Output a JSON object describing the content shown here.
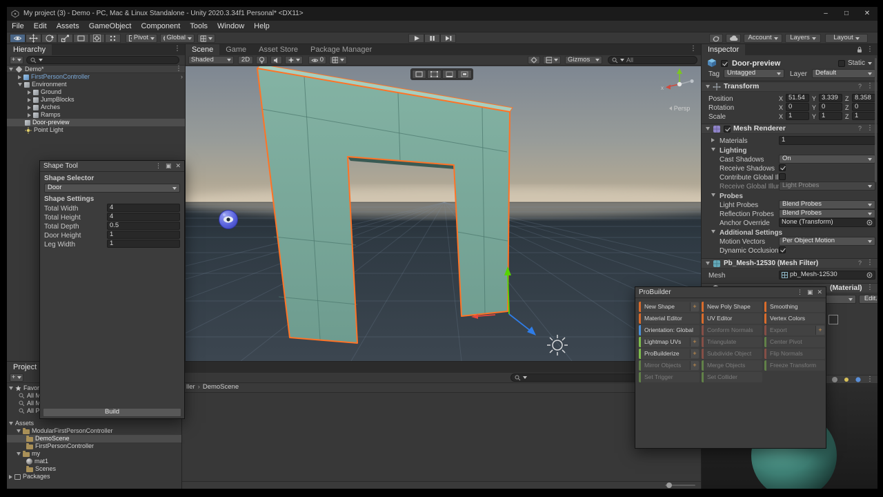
{
  "titlebar": {
    "title": "My project (3) - Demo - PC, Mac & Linux Standalone - Unity 2020.3.34f1 Personal* <DX11>",
    "minimize": "–",
    "maximize": "□",
    "close": "✕"
  },
  "menu": {
    "items": [
      "File",
      "Edit",
      "Assets",
      "GameObject",
      "Component",
      "Tools",
      "Window",
      "Help"
    ]
  },
  "toolbar": {
    "pivot": "Pivot",
    "global": "Global",
    "account": "Account",
    "layers": "Layers",
    "layout": "Layout"
  },
  "icons": {
    "kebab": "⋮",
    "pane_max": "▣",
    "close": "✕",
    "question": "?",
    "prefab_arrow": "›",
    "plus": "+"
  },
  "hierarchy": {
    "tab": "Hierarchy",
    "items": [
      {
        "label": "Demo*"
      },
      {
        "label": "FirstPersonController"
      },
      {
        "label": "Environment"
      },
      {
        "label": "Ground"
      },
      {
        "label": "JumpBlocks"
      },
      {
        "label": "Arches"
      },
      {
        "label": "Ramps"
      },
      {
        "label": "Door-preview"
      },
      {
        "label": "Point Light"
      }
    ]
  },
  "scene": {
    "tabs": [
      "Scene",
      "Game",
      "Asset Store",
      "Package Manager"
    ],
    "shaded": "Shaded",
    "two_d": "2D",
    "hidden_count": "0",
    "gizmos": "Gizmos",
    "search_text": "All",
    "axis_x_label": "x",
    "persp_label": "Persp"
  },
  "shape_tool": {
    "title": "Shape Tool",
    "selector_heading": "Shape Selector",
    "shape_value": "Door",
    "settings_heading": "Shape Settings",
    "fields": [
      {
        "label": "Total Width",
        "value": "4"
      },
      {
        "label": "Total Height",
        "value": "4"
      },
      {
        "label": "Total Depth",
        "value": "0.5"
      },
      {
        "label": "Door Height",
        "value": "1"
      },
      {
        "label": "Leg Width",
        "value": "1"
      }
    ],
    "build": "Build"
  },
  "probuilder": {
    "title": "ProBuilder",
    "buttons": [
      {
        "label": "New Shape",
        "category": "orange",
        "enabled": true,
        "plus": true
      },
      {
        "label": "New Poly Shape",
        "category": "orange",
        "enabled": true,
        "plus": false
      },
      {
        "label": "Smoothing",
        "category": "orange",
        "enabled": true,
        "plus": false
      },
      {
        "label": "Material Editor",
        "category": "orange",
        "enabled": true,
        "plus": false
      },
      {
        "label": "UV Editor",
        "category": "orange",
        "enabled": true,
        "plus": false
      },
      {
        "label": "Vertex Colors",
        "category": "orange",
        "enabled": true,
        "plus": false
      },
      {
        "label": "Orientation: Global",
        "category": "blue",
        "enabled": true,
        "plus": false
      },
      {
        "label": "Conform Normals",
        "category": "red",
        "enabled": false,
        "plus": false
      },
      {
        "label": "Export",
        "category": "red",
        "enabled": false,
        "plus": true
      },
      {
        "label": "Lightmap UVs",
        "category": "green",
        "enabled": true,
        "plus": true
      },
      {
        "label": "Triangulate",
        "category": "red",
        "enabled": false,
        "plus": false
      },
      {
        "label": "Center Pivot",
        "category": "green",
        "enabled": false,
        "plus": false
      },
      {
        "label": "ProBuilderize",
        "category": "green",
        "enabled": true,
        "plus": true
      },
      {
        "label": "Subdivide Object",
        "category": "red",
        "enabled": false,
        "plus": false
      },
      {
        "label": "Flip Normals",
        "category": "red",
        "enabled": false,
        "plus": false
      },
      {
        "label": "Mirror Objects",
        "category": "green",
        "enabled": false,
        "plus": true
      },
      {
        "label": "Merge Objects",
        "category": "green",
        "enabled": false,
        "plus": false
      },
      {
        "label": "Freeze Transform",
        "category": "green",
        "enabled": false,
        "plus": false
      },
      {
        "label": "Set Trigger",
        "category": "green",
        "enabled": false,
        "plus": false
      },
      {
        "label": "Set Collider",
        "category": "green",
        "enabled": false,
        "plus": false
      }
    ]
  },
  "project": {
    "tab": "Project",
    "favorites_label": "Favorites",
    "favorites": [
      "All Materials",
      "All Models",
      "All Prefabs"
    ],
    "assets_label": "Assets",
    "folders": {
      "modular": "ModularFirstPersonController",
      "demo_scene": "DemoScene",
      "fpc": "FirstPersonController",
      "my": "my",
      "mat1": "mat1",
      "scenes": "Scenes"
    },
    "packages_label": "Packages",
    "breadcrumb": {
      "parent": "ller",
      "separator": "›",
      "current": "DemoScene"
    }
  },
  "inspector": {
    "tab": "Inspector",
    "name": "Door-preview",
    "static_label": "Static",
    "tag_label": "Tag",
    "tag_value": "Untagged",
    "layer_label": "Layer",
    "layer_value": "Default",
    "axes": [
      "X",
      "Y",
      "Z"
    ],
    "transform": {
      "title": "Transform",
      "position_label": "Position",
      "rotation_label": "Rotation",
      "scale_label": "Scale",
      "position": {
        "x": "51.54",
        "y": "3.339",
        "z": "8.358"
      },
      "rotation": {
        "x": "0",
        "y": "0",
        "z": "0"
      },
      "scale": {
        "x": "1",
        "y": "1",
        "z": "1"
      }
    },
    "mesh_renderer": {
      "title": "Mesh Renderer",
      "materials_label": "Materials",
      "materials_value": "1",
      "lighting_label": "Lighting",
      "cast_shadows_label": "Cast Shadows",
      "cast_shadows_value": "On",
      "receive_shadows_label": "Receive Shadows",
      "contribute_gi_label": "Contribute Global Illu",
      "receive_gi_label": "Receive Global Illumi",
      "receive_gi_value": "Light Probes",
      "probes_label": "Probes",
      "light_probes_label": "Light Probes",
      "light_probes_value": "Blend Probes",
      "reflection_probes_label": "Reflection Probes",
      "reflection_probes_value": "Blend Probes",
      "anchor_label": "Anchor Override",
      "anchor_value": "None (Transform)",
      "additional_label": "Additional Settings",
      "motion_vectors_label": "Motion Vectors",
      "motion_vectors_value": "Per Object Motion",
      "dynamic_occlusion_label": "Dynamic Occlusion"
    },
    "mesh_filter": {
      "title": "Pb_Mesh-12530 (Mesh Filter)",
      "mesh_label": "Mesh",
      "mesh_value": "pb_Mesh-12530"
    },
    "material": {
      "title_visible": "(Material)",
      "edit_button": "Edit..."
    }
  },
  "colors": {
    "selection_orange": "#FF7326",
    "prefab_blue": "#7BA9D8",
    "door_teal": "#7FB3A4",
    "pb_orange": "#DA6C2C",
    "pb_blue": "#4A90D9",
    "pb_green": "#7FBF4D",
    "pb_red": "#C75B49"
  }
}
